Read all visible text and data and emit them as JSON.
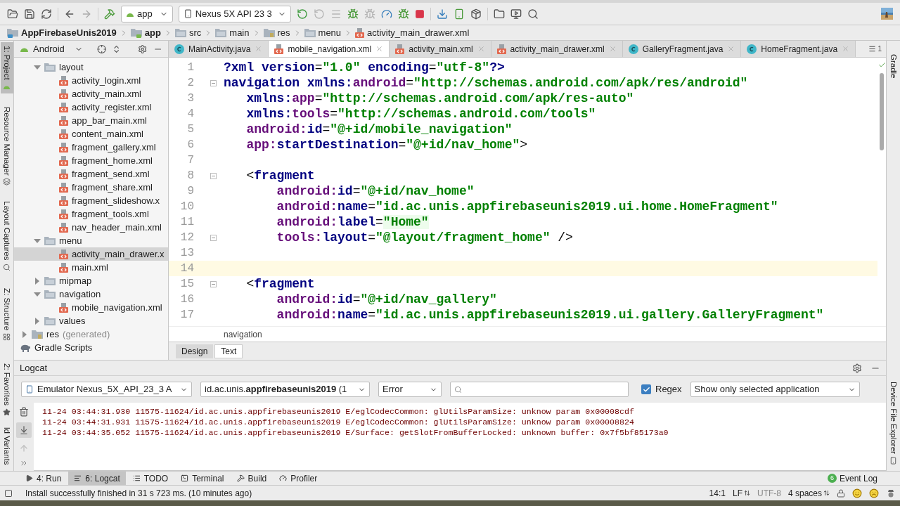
{
  "toolbar": {
    "configuration": "app",
    "device": "Nexus 5X API 23 3"
  },
  "breadcrumb": [
    {
      "label": "AppFirebaseUnis2019",
      "kind": "project",
      "bold": true
    },
    {
      "label": "app",
      "kind": "module",
      "bold": true
    },
    {
      "label": "src",
      "kind": "folder",
      "bold": false
    },
    {
      "label": "main",
      "kind": "folder",
      "bold": false
    },
    {
      "label": "res",
      "kind": "res",
      "bold": false
    },
    {
      "label": "menu",
      "kind": "folder",
      "bold": false
    },
    {
      "label": "activity_main_drawer.xml",
      "kind": "xml",
      "bold": false
    }
  ],
  "left_tool_tabs": [
    {
      "label": "1: Project",
      "selected": true,
      "kind": "android"
    },
    {
      "label": "Resource Manager",
      "selected": false,
      "kind": "resources"
    },
    {
      "label": "Layout Captures",
      "selected": false,
      "kind": "capture"
    },
    {
      "label": "Z: Structure",
      "selected": false,
      "kind": "structure"
    },
    {
      "label": "2: Favorites",
      "selected": false,
      "kind": "star"
    },
    {
      "label": "ld Variants",
      "selected": false,
      "kind": "none"
    }
  ],
  "right_tool_tabs": [
    {
      "label": "Gradle",
      "kind": "gradle"
    },
    {
      "label": "Device File Explorer",
      "kind": "phone"
    }
  ],
  "project_panel": {
    "view": "Android",
    "nested_items": [
      {
        "label": "layout",
        "kind": "folder",
        "expanded": true,
        "selected": false,
        "children": [
          {
            "label": "activity_login.xml",
            "kind": "xml",
            "selected": false
          },
          {
            "label": "activity_main.xml",
            "kind": "xml",
            "selected": false
          },
          {
            "label": "activity_register.xml",
            "kind": "xml",
            "selected": false
          },
          {
            "label": "app_bar_main.xml",
            "kind": "xml",
            "selected": false
          },
          {
            "label": "content_main.xml",
            "kind": "xml",
            "selected": false
          },
          {
            "label": "fragment_gallery.xml",
            "kind": "xml",
            "selected": false
          },
          {
            "label": "fragment_home.xml",
            "kind": "xml",
            "selected": false
          },
          {
            "label": "fragment_send.xml",
            "kind": "xml",
            "selected": false
          },
          {
            "label": "fragment_share.xml",
            "kind": "xml",
            "selected": false
          },
          {
            "label": "fragment_slideshow.x",
            "kind": "xml",
            "selected": false
          },
          {
            "label": "fragment_tools.xml",
            "kind": "xml",
            "selected": false
          },
          {
            "label": "nav_header_main.xml",
            "kind": "xml",
            "selected": false
          }
        ]
      },
      {
        "label": "menu",
        "kind": "folder",
        "expanded": true,
        "selected": false,
        "children": [
          {
            "label": "activity_main_drawer.x",
            "kind": "xml",
            "selected": true
          },
          {
            "label": "main.xml",
            "kind": "xml",
            "selected": false
          }
        ]
      },
      {
        "label": "mipmap",
        "kind": "folder",
        "expanded": false,
        "selected": false
      },
      {
        "label": "navigation",
        "kind": "folder",
        "expanded": true,
        "selected": false,
        "children": [
          {
            "label": "mobile_navigation.xml",
            "kind": "xml",
            "selected": false
          }
        ]
      },
      {
        "label": "values",
        "kind": "folder",
        "expanded": false,
        "selected": false
      }
    ],
    "module_items": [
      {
        "label": "res",
        "note": "(generated)",
        "kind": "res",
        "expanded": false,
        "selected": false
      }
    ],
    "root_items": [
      {
        "label": "Gradle Scripts",
        "kind": "gradle",
        "selected": false
      }
    ]
  },
  "editor_tabs": [
    {
      "label": "MainActivity.java",
      "kind": "java",
      "selected": false
    },
    {
      "label": "mobile_navigation.xml",
      "kind": "xml",
      "selected": true
    },
    {
      "label": "activity_main.xml",
      "kind": "xml",
      "selected": false
    },
    {
      "label": "activity_main_drawer.xml",
      "kind": "xml",
      "selected": false
    },
    {
      "label": "GalleryFragment.java",
      "kind": "java",
      "selected": false
    },
    {
      "label": "HomeFragment.java",
      "kind": "java",
      "selected": false
    }
  ],
  "hidden_tabs_count": "1",
  "code_lines": [
    {
      "number": "1",
      "foldable": false,
      "current": false,
      "tokens": [
        {
          "kind": "tag",
          "text": "?xml"
        },
        {
          "kind": "attr",
          "text": " version"
        },
        {
          "kind": "plain",
          "text": "="
        },
        {
          "kind": "value",
          "text": "\"1.0\""
        },
        {
          "kind": "attr",
          "text": " encoding"
        },
        {
          "kind": "plain",
          "text": "="
        },
        {
          "kind": "value",
          "text": "\"utf-8\""
        },
        {
          "kind": "tag",
          "text": "?>"
        }
      ]
    },
    {
      "number": "2",
      "foldable": true,
      "current": false,
      "tokens": [
        {
          "kind": "tag",
          "text": "navigation"
        },
        {
          "kind": "attr",
          "text": " xmlns:"
        },
        {
          "kind": "ns",
          "text": "android"
        },
        {
          "kind": "plain",
          "text": "="
        },
        {
          "kind": "value",
          "text": "\"http://schemas.android.com/apk/res/android\""
        }
      ]
    },
    {
      "number": "3",
      "foldable": false,
      "current": false,
      "tokens": [
        {
          "kind": "attr",
          "text": "   xmlns:"
        },
        {
          "kind": "ns",
          "text": "app"
        },
        {
          "kind": "plain",
          "text": "="
        },
        {
          "kind": "value",
          "text": "\"http://schemas.android.com/apk/res-auto\""
        }
      ]
    },
    {
      "number": "4",
      "foldable": false,
      "current": false,
      "tokens": [
        {
          "kind": "attr",
          "text": "   xmlns:"
        },
        {
          "kind": "ns",
          "text": "tools"
        },
        {
          "kind": "plain",
          "text": "="
        },
        {
          "kind": "value",
          "text": "\"http://schemas.android.com/tools\""
        }
      ]
    },
    {
      "number": "5",
      "foldable": false,
      "current": false,
      "tokens": [
        {
          "kind": "ns",
          "text": "   android:"
        },
        {
          "kind": "attr",
          "text": "id"
        },
        {
          "kind": "plain",
          "text": "="
        },
        {
          "kind": "value",
          "text": "\"@+id/mobile_navigation\""
        }
      ]
    },
    {
      "number": "6",
      "foldable": false,
      "current": false,
      "tokens": [
        {
          "kind": "ns",
          "text": "   app:"
        },
        {
          "kind": "attr",
          "text": "startDestination"
        },
        {
          "kind": "plain",
          "text": "="
        },
        {
          "kind": "value",
          "text": "\"@+id/nav_home\""
        },
        {
          "kind": "plain",
          "text": ">"
        }
      ]
    },
    {
      "number": "7",
      "foldable": false,
      "current": false
    },
    {
      "number": "8",
      "foldable": true,
      "current": false,
      "tokens": [
        {
          "kind": "plain",
          "text": "   <"
        },
        {
          "kind": "tag",
          "text": "fragment"
        }
      ]
    },
    {
      "number": "9",
      "foldable": false,
      "current": false,
      "tokens": [
        {
          "kind": "ns",
          "text": "       android:"
        },
        {
          "kind": "attr",
          "text": "id"
        },
        {
          "kind": "plain",
          "text": "="
        },
        {
          "kind": "value",
          "text": "\"@+id/nav_home\""
        }
      ]
    },
    {
      "number": "10",
      "foldable": false,
      "current": false,
      "tokens": [
        {
          "kind": "ns",
          "text": "       android:"
        },
        {
          "kind": "attr",
          "text": "name"
        },
        {
          "kind": "plain",
          "text": "="
        },
        {
          "kind": "value",
          "text": "\"id.ac.unis.appfirebaseunis2019.ui.home.HomeFragment\""
        }
      ]
    },
    {
      "number": "11",
      "foldable": false,
      "current": false,
      "tokens": [
        {
          "kind": "ns",
          "text": "       android:"
        },
        {
          "kind": "attr",
          "text": "label"
        },
        {
          "kind": "plain",
          "text": "="
        },
        {
          "kind": "string",
          "text": "\"Home\""
        }
      ]
    },
    {
      "number": "12",
      "foldable": true,
      "current": false,
      "tokens": [
        {
          "kind": "ns",
          "text": "       tools:"
        },
        {
          "kind": "attr",
          "text": "layout"
        },
        {
          "kind": "plain",
          "text": "="
        },
        {
          "kind": "value",
          "text": "\"@layout/fragment_home\""
        },
        {
          "kind": "plain",
          "text": " />"
        }
      ]
    },
    {
      "number": "13",
      "foldable": false,
      "current": false
    },
    {
      "number": "14",
      "foldable": false,
      "current": true
    },
    {
      "number": "15",
      "foldable": true,
      "current": false,
      "tokens": [
        {
          "kind": "plain",
          "text": "   <"
        },
        {
          "kind": "tag",
          "text": "fragment"
        }
      ]
    },
    {
      "number": "16",
      "foldable": false,
      "current": false,
      "tokens": [
        {
          "kind": "ns",
          "text": "       android:"
        },
        {
          "kind": "attr",
          "text": "id"
        },
        {
          "kind": "plain",
          "text": "="
        },
        {
          "kind": "value",
          "text": "\"@+id/nav_gallery\""
        }
      ]
    },
    {
      "number": "17",
      "foldable": false,
      "current": false,
      "tokens": [
        {
          "kind": "ns",
          "text": "       android:"
        },
        {
          "kind": "attr",
          "text": "name"
        },
        {
          "kind": "plain",
          "text": "="
        },
        {
          "kind": "value",
          "text": "\"id.ac.unis.appfirebaseunis2019.ui.gallery.GalleryFragment\""
        }
      ]
    }
  ],
  "editor_breadcrumb": "navigation",
  "view_tabs": [
    {
      "label": "Design",
      "selected": false
    },
    {
      "label": "Text",
      "selected": true
    }
  ],
  "logcat": {
    "title": "Logcat",
    "device": "Emulator Nexus_5X_API_23_3 A",
    "process": "id.ac.unis.**appfirebaseunis2019** (1",
    "level": "Error",
    "regex_label": "Regex",
    "regex_checked": true,
    "filter": "Show only selected application",
    "scroll_to_end_selected": true,
    "lines": [
      "11-24 03:44:31.930 11575-11624/id.ac.unis.appfirebaseunis2019 E/eglCodecCommon: glUtilsParamSize: unknow param 0x00008cdf",
      "11-24 03:44:31.931 11575-11624/id.ac.unis.appfirebaseunis2019 E/eglCodecCommon: glUtilsParamSize: unknow param 0x00008824",
      "11-24 03:44:35.052 11575-11624/id.ac.unis.appfirebaseunis2019 E/Surface: getSlotFromBufferLocked: unknown buffer: 0x7f5bf85173a0"
    ]
  },
  "bottom_tabs": [
    {
      "label": "4: Run",
      "kind": "run",
      "selected": false
    },
    {
      "label": "6: Logcat",
      "kind": "logcat",
      "selected": true
    },
    {
      "label": "TODO",
      "kind": "todo",
      "selected": false
    },
    {
      "label": "Terminal",
      "kind": "terminal",
      "selected": false
    },
    {
      "label": "Build",
      "kind": "build",
      "selected": false
    },
    {
      "label": "Profiler",
      "kind": "profiler",
      "selected": false
    }
  ],
  "event_log": {
    "label": "Event Log",
    "count": "6"
  },
  "status_bar": {
    "message": "Install successfully finished in 31 s 723 ms. (10 minutes ago)",
    "position": "14:1",
    "line_separator": "LF",
    "encoding": "UTF-8",
    "indent": "4 spaces"
  }
}
